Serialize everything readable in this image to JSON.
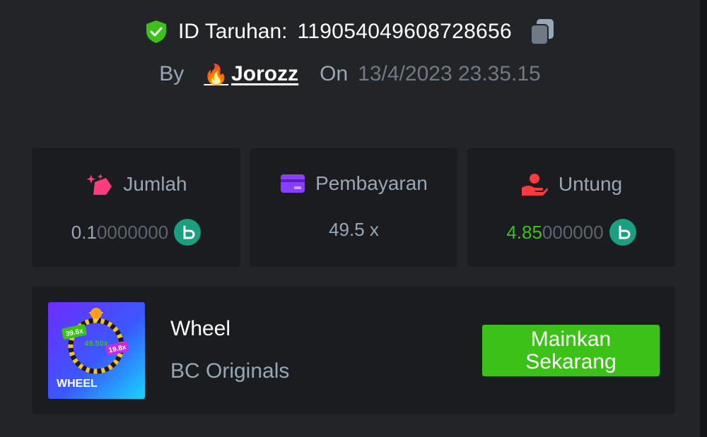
{
  "bet": {
    "id_label": "ID Taruhan:",
    "id_value": "119054049608728656"
  },
  "meta": {
    "by_label": "By",
    "user_emoji": "🔥",
    "username": "Jorozz",
    "on_label": "On",
    "date": "13/4/2023 23.35.15"
  },
  "stats": {
    "amount": {
      "label": "Jumlah",
      "value_bright": "0.1",
      "value_dim": "0000000"
    },
    "payout": {
      "label": "Pembayaran",
      "value": "49.5 x"
    },
    "profit": {
      "label": "Untung",
      "value_bright": "4.85",
      "value_dim": "000000"
    }
  },
  "game": {
    "name": "Wheel",
    "provider": "BC Originals",
    "thumb_label": "WHEEL",
    "thumb_values": [
      "39.6x",
      "49.50x",
      "19.8x"
    ],
    "play_label": "Mainkan\nSekarang"
  },
  "colors": {
    "accent_green": "#3bc117",
    "coin_teal": "#1aa081",
    "shield_green": "#3bc117",
    "jumlah_pink": "#ff3b7f",
    "pembayaran_purple": "#8b3dff",
    "untung_red": "#ff3b3b"
  },
  "icons": [
    "shield-check-icon",
    "copy-icon",
    "coin-icon",
    "wallet-card-icon",
    "hand-heart-icon"
  ]
}
